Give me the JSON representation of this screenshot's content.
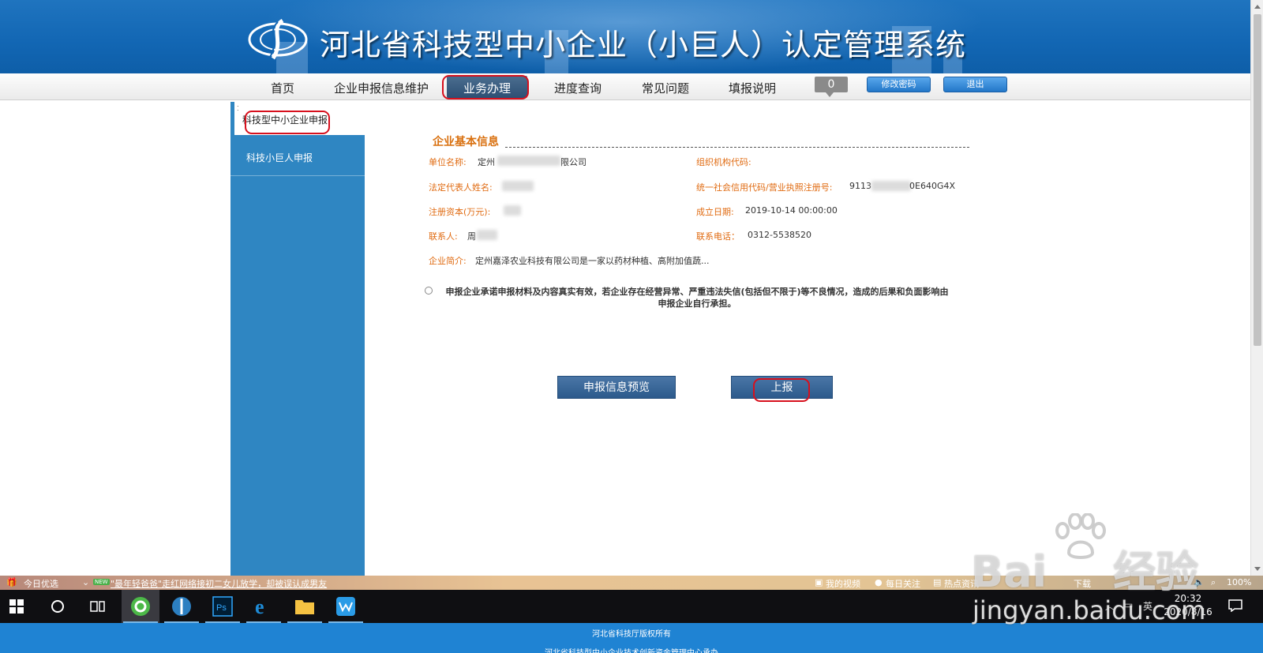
{
  "banner": {
    "title": "河北省科技型中小企业（小巨人）认定管理系统"
  },
  "nav": {
    "items": [
      "首页",
      "企业申报信息维护",
      "业务办理",
      "进度查询",
      "常见问题",
      "填报说明"
    ],
    "message_count": "0",
    "change_password": "修改密码",
    "logout": "退出"
  },
  "sidebar": {
    "items": [
      "科技型中小企业申报",
      "科技小巨人申报"
    ]
  },
  "info": {
    "section_title": "企业基本信息",
    "company_name_label": "单位名称:",
    "company_name_value_a": "定州",
    "company_name_value_b": "限公司",
    "org_code_label": "组织机构代码:",
    "legal_rep_label": "法定代表人姓名:",
    "credit_code_label": "统一社会信用代码/营业执照注册号:",
    "credit_code_value_a": "9113",
    "credit_code_value_b": "0E640G4X",
    "capital_label": "注册资本(万元):",
    "founded_label": "成立日期:",
    "founded_value": "2019-10-14 00:00:00",
    "contact_label": "联系人:",
    "contact_value": "周",
    "phone_label": "联系电话：",
    "phone_value": "0312-5538520",
    "intro_label": "企业简介:",
    "intro_value": "定州嘉泽农业科技有限公司是一家以药材种植、高附加值蔬..."
  },
  "pledge": {
    "line1": "申报企业承诺申报材料及内容真实有效，若企业存在经营异常、严重违法失信(包括但不限于)等不良情况，造成的后果和负面影响由",
    "line2": "申报企业自行承担。"
  },
  "actions": {
    "preview": "申报信息预览",
    "submit": "上报"
  },
  "ticker": {
    "channel": "今日优选",
    "new_tag": "NEW",
    "headline": "\"最年轻爸爸\"走红网络接初二女儿放学，却被误认成男友",
    "right_items": [
      "我的视频",
      "每日关注",
      "热点资讯",
      "下载"
    ],
    "zoom": "100%"
  },
  "taskbar": {
    "time": "20:32",
    "date": "2020/8/16",
    "ime": "英"
  },
  "footer": {
    "line1": "河北省科技厅版权所有",
    "line2": "河北省科技型中小企业技术创新资金管理中心承办"
  },
  "watermark": {
    "brand": "Bai",
    "brand2": "经验",
    "url": "jingyan.baidu.com"
  }
}
